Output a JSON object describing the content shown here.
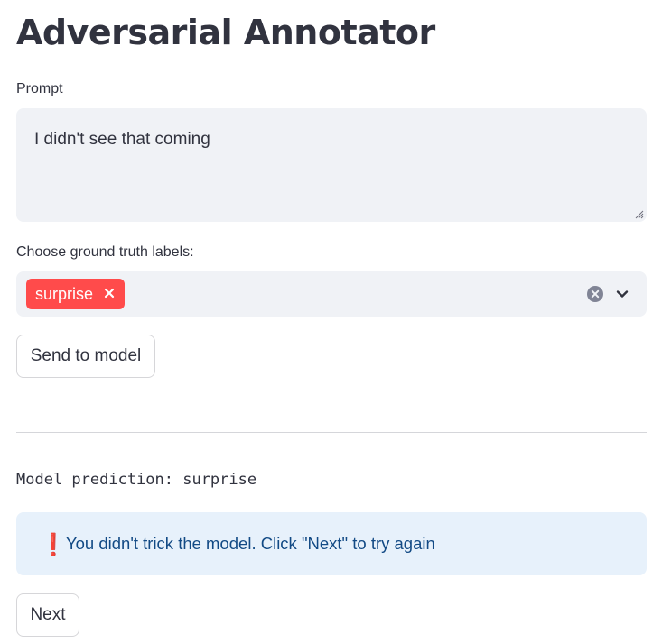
{
  "page": {
    "title": "Adversarial Annotator"
  },
  "prompt": {
    "label": "Prompt",
    "value": "I didn't see that coming"
  },
  "labels": {
    "label": "Choose ground truth labels:",
    "selected": [
      "surprise"
    ],
    "tag_color": "#ff4b4b",
    "clear_icon": "clear-circle-icon",
    "dropdown_icon": "chevron-down-icon"
  },
  "actions": {
    "send_label": "Send to model",
    "next_label": "Next"
  },
  "result": {
    "prediction_text": "Model prediction: surprise",
    "alert_icon": "exclamation-icon",
    "alert_symbol": "❗",
    "alert_text": "You didn't trick the model. Click \"Next\" to try again",
    "alert_bg": "#e7f1fb",
    "alert_text_color": "#124a85"
  }
}
